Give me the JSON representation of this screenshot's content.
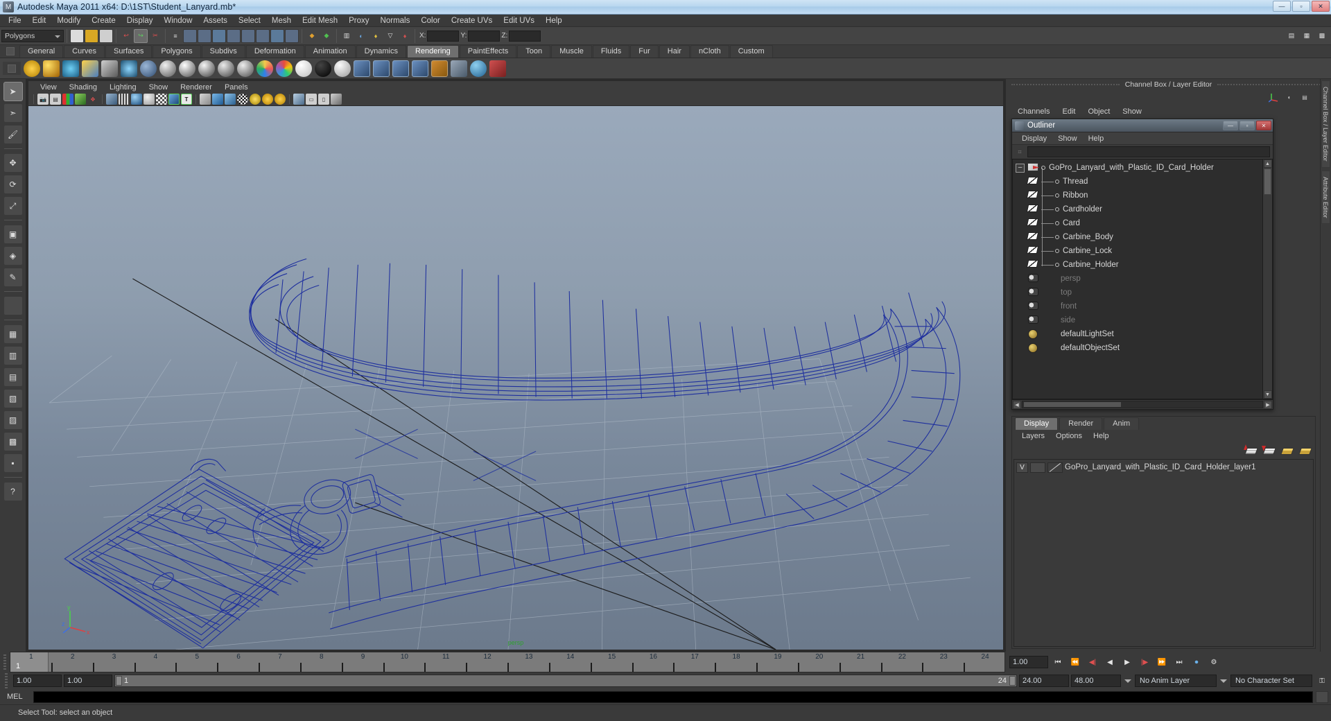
{
  "window": {
    "title": "Autodesk Maya 2011 x64: D:\\1ST\\Student_Lanyard.mb*",
    "minimize": "—",
    "maximize": "▫",
    "close": "✕"
  },
  "menubar": [
    "File",
    "Edit",
    "Modify",
    "Create",
    "Display",
    "Window",
    "Assets",
    "Select",
    "Mesh",
    "Edit Mesh",
    "Proxy",
    "Normals",
    "Color",
    "Create UVs",
    "Edit UVs",
    "Help"
  ],
  "statusline": {
    "mode_selector": "Polygons",
    "x_label": "X:",
    "y_label": "Y:",
    "z_label": "Z:",
    "x_value": "",
    "y_value": "",
    "z_value": ""
  },
  "shelf": {
    "tabs": [
      "General",
      "Curves",
      "Surfaces",
      "Polygons",
      "Subdivs",
      "Deformation",
      "Animation",
      "Dynamics",
      "Rendering",
      "PaintEffects",
      "Toon",
      "Muscle",
      "Fluids",
      "Fur",
      "Hair",
      "nCloth",
      "Custom"
    ],
    "active_tab": "Rendering"
  },
  "viewport": {
    "menus": [
      "View",
      "Shading",
      "Lighting",
      "Show",
      "Renderer",
      "Panels"
    ],
    "axis": {
      "y": "y",
      "x": "x",
      "z": "z"
    },
    "camera_label": "persp"
  },
  "channelbox": {
    "title": "Channel Box / Layer Editor",
    "menus": [
      "Channels",
      "Edit",
      "Object",
      "Show"
    ]
  },
  "side_tabs": [
    "Channel Box / Layer Editor",
    "Attribute Editor"
  ],
  "outliner": {
    "title": "Outliner",
    "menus": [
      "Display",
      "Show",
      "Help"
    ],
    "search_value": "",
    "minimize": "—",
    "maximize": "▫",
    "close": "✕",
    "expand_glyph": "–",
    "items": [
      {
        "label": "GoPro_Lanyard_with_Plastic_ID_Card_Holder",
        "icon": "transform-icon",
        "type": "root",
        "dim": false
      },
      {
        "label": "Thread",
        "icon": "mesh-icon",
        "type": "child",
        "dim": false
      },
      {
        "label": "Ribbon",
        "icon": "mesh-icon",
        "type": "child",
        "dim": false
      },
      {
        "label": "Cardholder",
        "icon": "mesh-icon",
        "type": "child",
        "dim": false
      },
      {
        "label": "Card",
        "icon": "mesh-icon",
        "type": "child",
        "dim": false
      },
      {
        "label": "Carbine_Body",
        "icon": "mesh-icon",
        "type": "child",
        "dim": false
      },
      {
        "label": "Carbine_Lock",
        "icon": "mesh-icon",
        "type": "child",
        "dim": false
      },
      {
        "label": "Carbine_Holder",
        "icon": "mesh-icon",
        "type": "child",
        "dim": false
      },
      {
        "label": "persp",
        "icon": "camera-icon",
        "type": "camera",
        "dim": true
      },
      {
        "label": "top",
        "icon": "camera-icon",
        "type": "camera",
        "dim": true
      },
      {
        "label": "front",
        "icon": "camera-icon",
        "type": "camera",
        "dim": true
      },
      {
        "label": "side",
        "icon": "camera-icon",
        "type": "camera",
        "dim": true
      },
      {
        "label": "defaultLightSet",
        "icon": "set-icon",
        "type": "set",
        "dim": false
      },
      {
        "label": "defaultObjectSet",
        "icon": "set-icon",
        "type": "set",
        "dim": false
      }
    ]
  },
  "layer_editor": {
    "tabs": [
      "Display",
      "Render",
      "Anim"
    ],
    "active_tab": "Display",
    "menus": [
      "Layers",
      "Options",
      "Help"
    ],
    "icons": [
      "move-layer-up-icon",
      "move-layer-down-icon",
      "new-layer-icon",
      "new-layer-from-selected-icon"
    ],
    "layers": [
      {
        "visibility": "V",
        "shading": "",
        "name": "GoPro_Lanyard_with_Plastic_ID_Card_Holder_layer1"
      }
    ]
  },
  "timeline": {
    "ticks": [
      "1",
      "2",
      "3",
      "4",
      "5",
      "6",
      "7",
      "8",
      "9",
      "10",
      "11",
      "12",
      "13",
      "14",
      "15",
      "16",
      "17",
      "18",
      "19",
      "20",
      "21",
      "22",
      "23",
      "24"
    ],
    "current_frame_label": "1",
    "current_frame_field": "1.00",
    "range_start_field": "1.00",
    "range_min_field": "1.00",
    "range_bar_start": "1",
    "range_bar_end": "24",
    "range_end_field": "24.00",
    "playback_end_field": "48.00",
    "anim_layer": "No Anim Layer",
    "character_set": "No Character Set",
    "playback_buttons": [
      "go-to-start",
      "step-back-key",
      "step-back-frame",
      "play-backwards",
      "play-forwards",
      "step-forward-frame",
      "step-forward-key",
      "go-to-end"
    ]
  },
  "command_line": {
    "label": "MEL",
    "value": ""
  },
  "statusbar": {
    "message": "Select Tool: select an object"
  }
}
